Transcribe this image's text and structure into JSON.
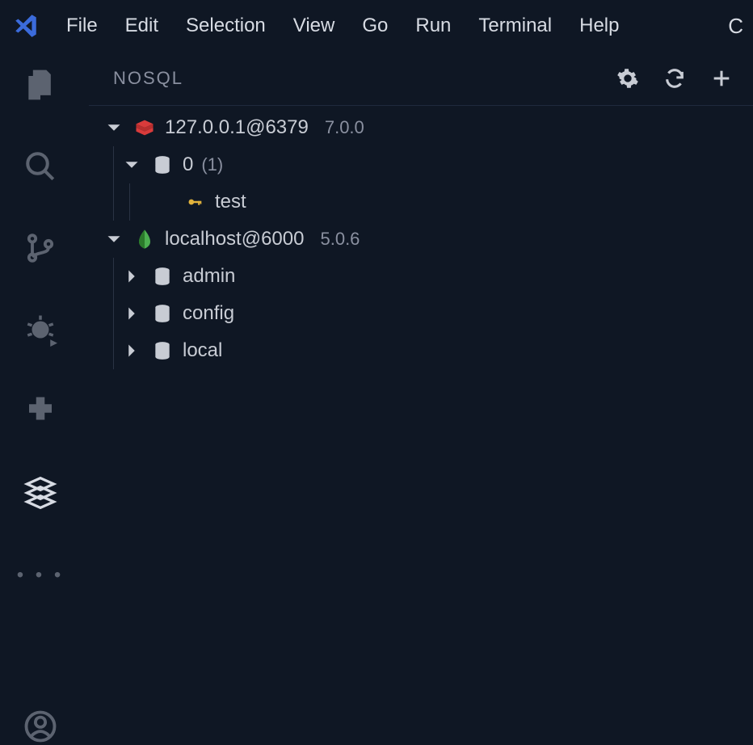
{
  "menu": {
    "items": [
      "File",
      "Edit",
      "Selection",
      "View",
      "Go",
      "Run",
      "Terminal",
      "Help"
    ],
    "overflow": "C"
  },
  "panel": {
    "title": "NOSQL"
  },
  "connections": [
    {
      "type": "redis",
      "label": "127.0.0.1@6379",
      "version": "7.0.0",
      "expanded": true,
      "databases": [
        {
          "name": "0",
          "count": "(1)",
          "expanded": true,
          "keys": [
            {
              "name": "test"
            }
          ]
        }
      ]
    },
    {
      "type": "mongo",
      "label": "localhost@6000",
      "version": "5.0.6",
      "expanded": true,
      "databases": [
        {
          "name": "admin",
          "expanded": false
        },
        {
          "name": "config",
          "expanded": false
        },
        {
          "name": "local",
          "expanded": false
        }
      ]
    }
  ]
}
